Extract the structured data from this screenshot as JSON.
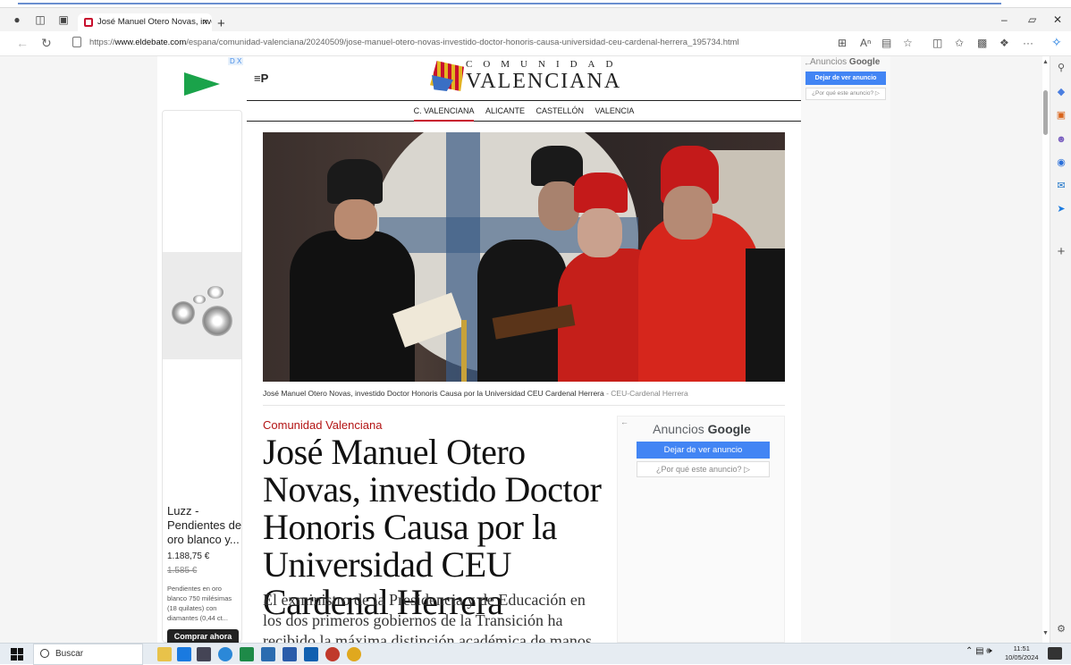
{
  "browser": {
    "tab_title": "José Manuel Otero Novas, invest",
    "tab_close": "×",
    "new_tab": "+",
    "url_prefix": "https://",
    "url_domain": "www.eldebate.com",
    "url_path": "/espana/comunidad-valenciana/20240509/jose-manuel-otero-novas-investido-doctor-honoris-causa-universidad-ceu-cardenal-herrera_195734.html",
    "more": "···"
  },
  "site": {
    "logo_top": "COMUNIDAD",
    "logo_bottom": "VALENCIANA",
    "menu_glyph": "≡P",
    "nav": [
      "C. VALENCIANA",
      "ALICANTE",
      "CASTELLÓN",
      "VALENCIA"
    ]
  },
  "article": {
    "caption": "José Manuel Otero Novas, investido Doctor Honoris Causa por la Universidad CEU Cardenal Herrera",
    "caption_source": " - CEU-Cardenal Herrera",
    "section": "Comunidad Valenciana",
    "headline": "José Manuel Otero Novas, investido Doctor Honoris Causa por la Universidad CEU Cardenal Herrera",
    "lede": "El exministro de la Presidencia y de Educación en los dos primeros gobiernos de la Transición ha recibido la máxima distinción académica de manos del rector"
  },
  "ads": {
    "product_title": "Luzz - Pendientes de oro blanco y...",
    "price": "1.188,75 €",
    "old_price": "1.585 €",
    "description": "Pendientes en oro blanco 750 milésimas (18 quilates) con diamantes (0,44 ct...",
    "buy_button": "Comprar ahora",
    "ad_choices": "D X",
    "google_label_prefix": "Anuncios ",
    "google_label_brand": "Google",
    "stop_ad": "Dejar de ver anuncio",
    "why_ad": "¿Por qué este anuncio? ▷"
  },
  "taskbar": {
    "search_label": "Buscar",
    "time": "11:51",
    "date": "10/05/2024"
  },
  "colors": {
    "brand_red": "#c8102e",
    "google_blue": "#4285f4",
    "ad_green": "#1aa34a"
  },
  "icons": [
    "profile-icon",
    "workspaces-icon",
    "tab-actions-icon",
    "back-icon",
    "refresh-icon",
    "lock-icon",
    "apps-icon",
    "read-aloud-icon",
    "immersive-reader-icon",
    "favorite-icon",
    "split-screen-icon",
    "favorites-icon",
    "collections-icon",
    "extensions-icon",
    "copilot-icon",
    "windows-icon",
    "search-icon"
  ]
}
